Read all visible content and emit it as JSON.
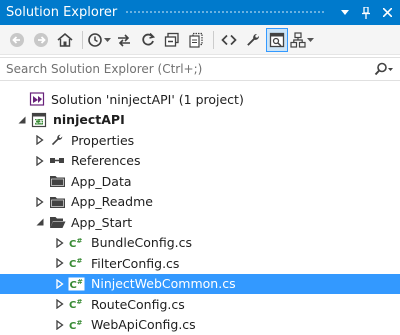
{
  "titlebar": {
    "title": "Solution Explorer"
  },
  "search": {
    "placeholder": "Search Solution Explorer (Ctrl+;)"
  },
  "tree": {
    "items": [
      {
        "label": "Solution 'ninjectAPI' (1 project)",
        "icon": "solution-icon",
        "expander": "none",
        "bold": false,
        "selected": false
      },
      {
        "label": "ninjectAPI",
        "icon": "csharp-project-icon",
        "expander": "expanded",
        "bold": true,
        "selected": false
      },
      {
        "label": "Properties",
        "icon": "wrench-icon",
        "expander": "collapsed",
        "bold": false,
        "selected": false
      },
      {
        "label": "References",
        "icon": "references-icon",
        "expander": "collapsed",
        "bold": false,
        "selected": false
      },
      {
        "label": "App_Data",
        "icon": "folder-icon",
        "expander": "none",
        "bold": false,
        "selected": false
      },
      {
        "label": "App_Readme",
        "icon": "folder-icon",
        "expander": "collapsed",
        "bold": false,
        "selected": false
      },
      {
        "label": "App_Start",
        "icon": "folder-open-icon",
        "expander": "expanded",
        "bold": false,
        "selected": false
      },
      {
        "label": "BundleConfig.cs",
        "icon": "csharp-file-icon",
        "expander": "collapsed",
        "bold": false,
        "selected": false
      },
      {
        "label": "FilterConfig.cs",
        "icon": "csharp-file-icon",
        "expander": "collapsed",
        "bold": false,
        "selected": false
      },
      {
        "label": "NinjectWebCommon.cs",
        "icon": "csharp-file-icon",
        "expander": "collapsed",
        "bold": false,
        "selected": true
      },
      {
        "label": "RouteConfig.cs",
        "icon": "csharp-file-icon",
        "expander": "collapsed",
        "bold": false,
        "selected": false
      },
      {
        "label": "WebApiConfig.cs",
        "icon": "csharp-file-icon",
        "expander": "collapsed",
        "bold": false,
        "selected": false
      }
    ]
  },
  "colors": {
    "title_bar": "#007acc",
    "selection": "#3399ff",
    "csharp_green": "#388a34",
    "folder": "#424242"
  }
}
